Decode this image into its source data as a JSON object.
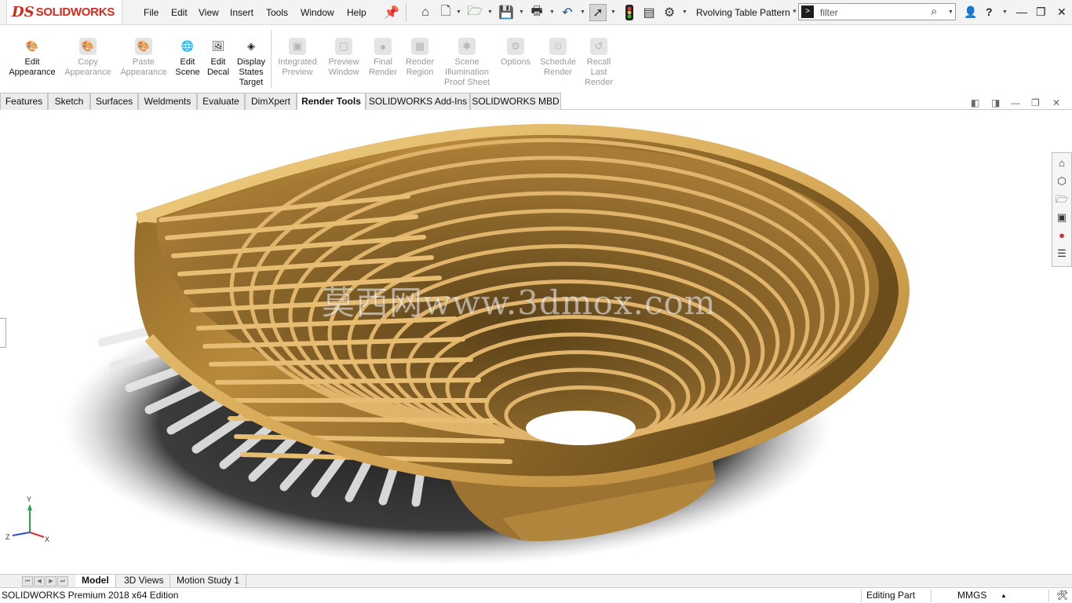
{
  "app": {
    "brand_prefix": "DS",
    "brand_name": "SOLIDWORKS"
  },
  "menu": [
    "File",
    "Edit",
    "View",
    "Insert",
    "Tools",
    "Window",
    "Help"
  ],
  "toolbar_icons": [
    "pin-icon",
    "home-icon",
    "new-document-icon",
    "open-icon",
    "save-icon",
    "print-icon",
    "undo-icon",
    "select-icon",
    "rebuild-icon",
    "file-properties-icon",
    "options-icon"
  ],
  "document": {
    "title": "Rvolving Table Pattern *"
  },
  "search": {
    "placeholder": "filter"
  },
  "command_manager": {
    "buttons": [
      {
        "label": "Edit\nAppearance",
        "enabled": true,
        "icon": "edit-appearance-icon"
      },
      {
        "label": "Copy\nAppearance",
        "enabled": false,
        "icon": "copy-appearance-icon"
      },
      {
        "label": "Paste\nAppearance",
        "enabled": false,
        "icon": "paste-appearance-icon"
      },
      {
        "label": "Edit\nScene",
        "enabled": true,
        "icon": "edit-scene-icon"
      },
      {
        "label": "Edit\nDecal",
        "enabled": true,
        "icon": "edit-decal-icon"
      },
      {
        "label": "Display\nStates\nTarget",
        "enabled": true,
        "icon": "display-states-icon"
      },
      {
        "label": "Integrated\nPreview",
        "enabled": false,
        "icon": "integrated-preview-icon"
      },
      {
        "label": "Preview\nWindow",
        "enabled": false,
        "icon": "preview-window-icon"
      },
      {
        "label": "Final\nRender",
        "enabled": false,
        "icon": "final-render-icon"
      },
      {
        "label": "Render\nRegion",
        "enabled": false,
        "icon": "render-region-icon"
      },
      {
        "label": "Scene\nIllumination\nProof Sheet",
        "enabled": false,
        "icon": "illumination-icon"
      },
      {
        "label": "Options",
        "enabled": false,
        "icon": "render-options-icon"
      },
      {
        "label": "Schedule\nRender",
        "enabled": false,
        "icon": "schedule-render-icon"
      },
      {
        "label": "Recall\nLast\nRender",
        "enabled": false,
        "icon": "recall-render-icon"
      }
    ]
  },
  "tabs": [
    {
      "label": "Features",
      "active": false
    },
    {
      "label": "Sketch",
      "active": false
    },
    {
      "label": "Surfaces",
      "active": false
    },
    {
      "label": "Weldments",
      "active": false
    },
    {
      "label": "Evaluate",
      "active": false
    },
    {
      "label": "DimXpert",
      "active": false
    },
    {
      "label": "Render Tools",
      "active": true
    },
    {
      "label": "SOLIDWORKS Add-Ins",
      "active": false
    },
    {
      "label": "SOLIDWORKS MBD",
      "active": false
    }
  ],
  "viewport": {
    "watermark": "莫西网www.3dmox.com",
    "triad": {
      "y": "Y",
      "x": "X",
      "z": "Z"
    },
    "model_color": "#c99a4a",
    "task_pane_icons": [
      "home-icon",
      "parts-library-icon",
      "file-explorer-icon",
      "view-palette-icon",
      "appearances-icon",
      "custom-properties-icon"
    ]
  },
  "bottom_tabs": [
    {
      "label": "Model",
      "active": true
    },
    {
      "label": "3D Views",
      "active": false
    },
    {
      "label": "Motion Study 1",
      "active": false
    }
  ],
  "status": {
    "edition": "SOLIDWORKS Premium 2018 x64 Edition",
    "mode": "Editing Part",
    "units": "MMGS"
  }
}
